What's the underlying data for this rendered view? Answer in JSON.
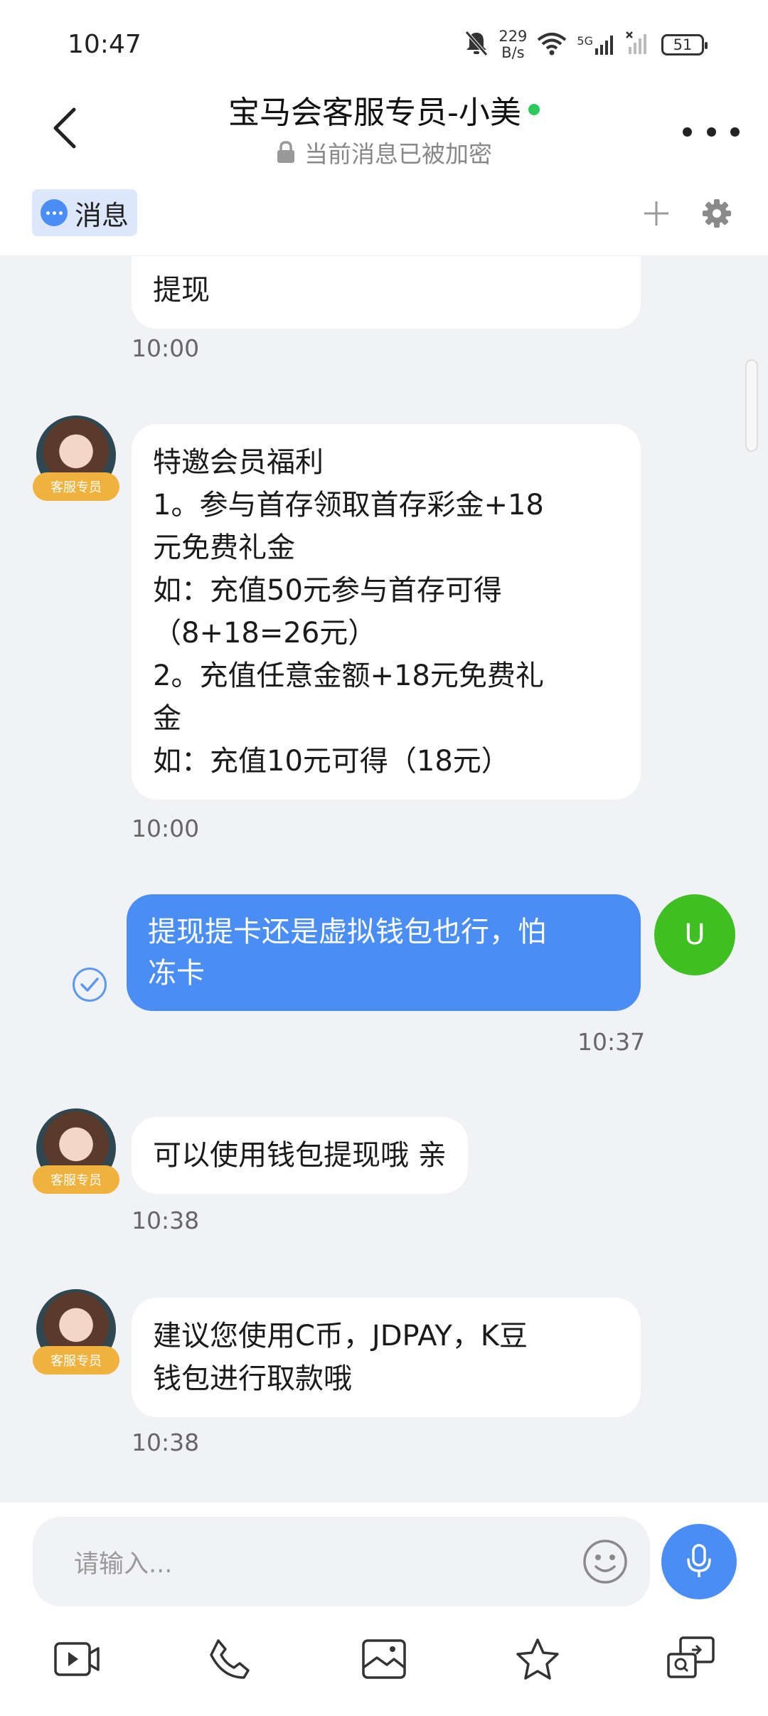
{
  "status_bar": {
    "time": "10:47",
    "net_speed_value": "229",
    "net_speed_unit": "B/s",
    "network": "5G",
    "battery": "51"
  },
  "header": {
    "title": "宝马会客服专员-小美",
    "subtitle": "当前消息已被加密",
    "online_color": "#2bc95a"
  },
  "tabs": {
    "messages_label": "消息"
  },
  "agent": {
    "badge": "客服专员"
  },
  "user": {
    "avatar_letter": "U"
  },
  "messages": [
    {
      "side": "in",
      "lines": [
        "提现"
      ],
      "time": "10:00"
    },
    {
      "side": "in",
      "lines": [
        "特邀会员福利",
        "1。参与首存领取首存彩金+18",
        "元免费礼金",
        "如：充值50元参与首存可得",
        "（8+18=26元）",
        "2。充值任意金额+18元免费礼",
        "金",
        "如：充值10元可得（18元）"
      ],
      "time": "10:00"
    },
    {
      "side": "out",
      "lines": [
        "提现提卡还是虚拟钱包也行，怕",
        "冻卡"
      ],
      "time": "10:37"
    },
    {
      "side": "in",
      "lines": [
        "可以使用钱包提现哦 亲"
      ],
      "time": "10:38"
    },
    {
      "side": "in",
      "lines": [
        "建议您使用C币，JDPAY，K豆",
        "钱包进行取款哦"
      ],
      "time": "10:38"
    }
  ],
  "input": {
    "placeholder": "请输入..."
  },
  "colors": {
    "accent": "#4a8ef5",
    "badge": "#f0b23c",
    "user_avatar": "#3fbf22",
    "chat_bg": "#f0f2f5"
  },
  "icons": {
    "toolbar": [
      "video-icon",
      "phone-icon",
      "image-icon",
      "star-icon",
      "screen-share-icon"
    ]
  }
}
